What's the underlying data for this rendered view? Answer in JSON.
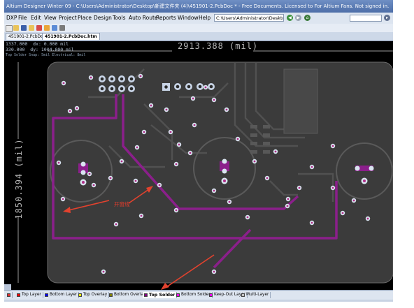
{
  "window": {
    "title": "Altium Designer Winter 09 - C:\\Users\\Administrator\\Desktop\\新建文件夹 (4)\\451901-2.PcbDoc * - Free Documents. Licensed to For Altium Fans. Not signed in."
  },
  "menu": {
    "items": [
      "DXP",
      "File",
      "Edit",
      "View",
      "Project",
      "Place",
      "Design",
      "Tools",
      "Auto Route",
      "Reports",
      "Window",
      "Help"
    ],
    "path": "C:\\Users\\Administrator\\Deskto"
  },
  "tabs": [
    {
      "label": "451901-2.PcbDoc *",
      "active": false
    },
    {
      "label": "451901-2.PcbDoc.htm",
      "active": true
    }
  ],
  "readout": {
    "x": "1337.000",
    "dx": "dx: 0.000 mil",
    "y": "330.000",
    "dy": "dy: 1004.000 mil",
    "status": "Top Solder  Snap: 5mil Electrical: 8mil"
  },
  "dimensions": {
    "horizontal": "2913.388 (mil)",
    "vertical": "1850.394 (mil)"
  },
  "annotation": {
    "text": "开窗线",
    "color": "#e23c2c"
  },
  "layers": [
    {
      "label": "Top Layer",
      "color": "#ff0000",
      "active": false
    },
    {
      "label": "Bottom Layer",
      "color": "#0000ff",
      "active": false
    },
    {
      "label": "Top Overlay",
      "color": "#ffff00",
      "active": false
    },
    {
      "label": "Bottom Overlay",
      "color": "#808000",
      "active": false
    },
    {
      "label": "Top Solder",
      "color": "#800080",
      "active": true
    },
    {
      "label": "Bottom Solder",
      "color": "#ff00ff",
      "active": false
    },
    {
      "label": "Keep-Out Layer",
      "color": "#ff00ff",
      "active": false
    },
    {
      "label": "Multi-Layer",
      "color": "#c0c0c0",
      "active": false
    }
  ],
  "colors": {
    "board": "#3b3b3b",
    "copper_trace": "#4a4a4a",
    "solder_mask": "#8b1f8b",
    "pad": "#c8d4e6",
    "via_ring": "#d9e4f0",
    "via_hole": "#b02e86",
    "arrow": "#e2422e"
  }
}
